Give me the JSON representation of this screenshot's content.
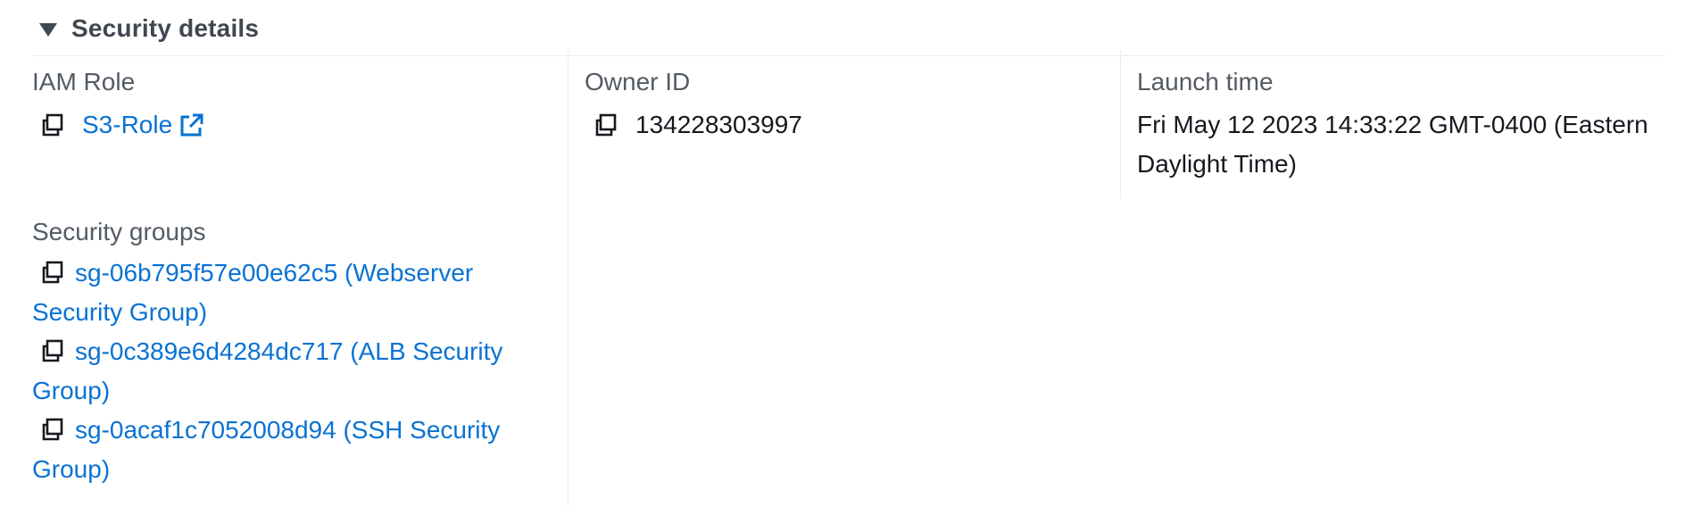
{
  "section": {
    "title": "Security details",
    "expanded": true
  },
  "iam_role": {
    "label": "IAM Role",
    "value": "S3-Role",
    "icons": [
      "copy-icon",
      "external-link-icon"
    ]
  },
  "owner_id": {
    "label": "Owner ID",
    "value": "134228303997",
    "icons": [
      "copy-icon"
    ]
  },
  "launch_time": {
    "label": "Launch time",
    "value": "Fri May 12 2023 14:33:22 GMT-0400 (Eastern Daylight Time)"
  },
  "security_groups": {
    "label": "Security groups",
    "items": [
      {
        "text": "sg-06b795f57e00e62c5 (Webserver Security Group)"
      },
      {
        "text": "sg-0c389e6d4284dc717 (ALB Security Group)"
      },
      {
        "text": "sg-0acaf1c7052008d94 (SSH Security Group)"
      }
    ]
  },
  "colors": {
    "link": "#0972d3",
    "label": "#545b64",
    "value": "#16191f",
    "header": "#414750",
    "divider": "#e9ebed"
  }
}
